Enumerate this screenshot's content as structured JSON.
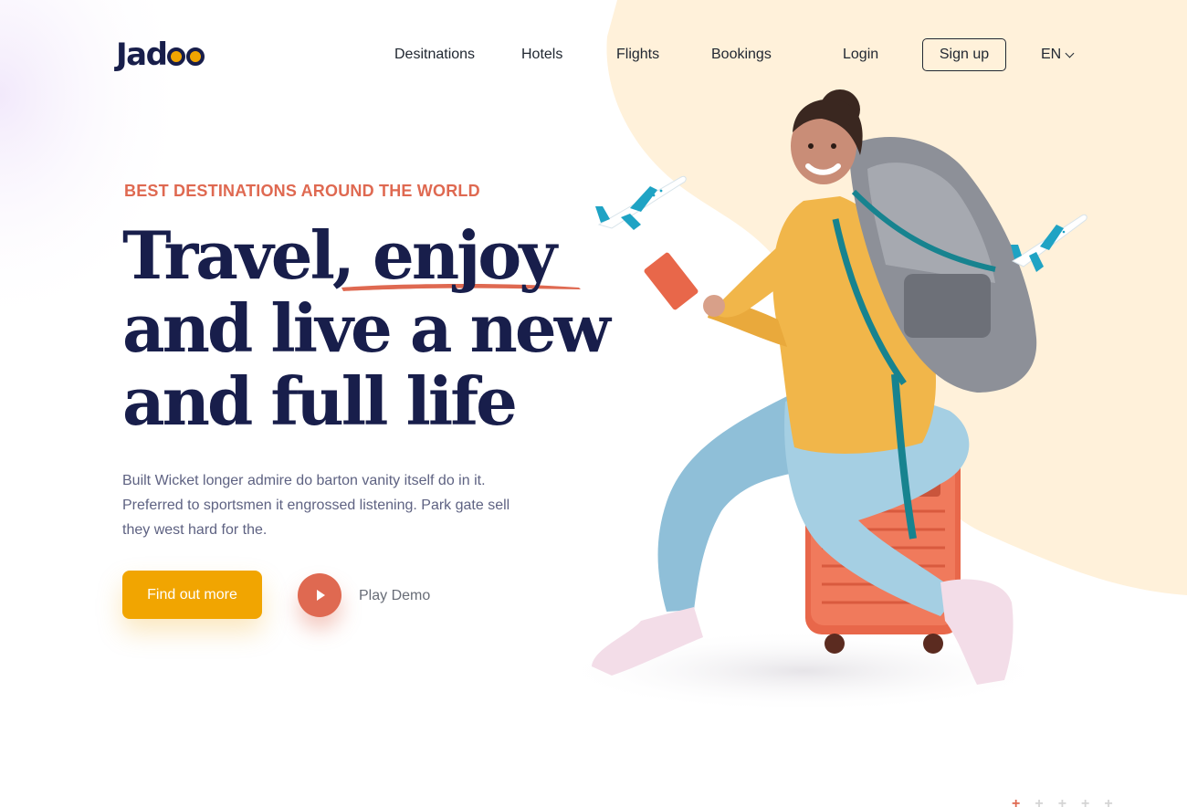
{
  "brand": {
    "logo_text_prefix": "Jad",
    "logo_text_suffix": "oo",
    "accent": "#df6951",
    "cta_color": "#f1a501",
    "heading_color": "#181e4b",
    "cream": "#fff1da"
  },
  "nav": {
    "items": [
      {
        "label": "Desitnations"
      },
      {
        "label": "Hotels"
      },
      {
        "label": "Flights"
      },
      {
        "label": "Bookings"
      },
      {
        "label": "Login"
      }
    ],
    "signup_label": "Sign up",
    "language": "EN",
    "language_icon": "chevron-down-icon"
  },
  "hero": {
    "eyebrow": "BEST DESTINATIONS AROUND THE WORLD",
    "headline_line1": "Travel, enjoy",
    "headline_line2": "and live a new",
    "headline_line3": "and full life",
    "description": "Built Wicket longer admire do barton vanity itself do in it. Preferred to sportsmen it engrossed listening. Park gate sell they west hard for the.",
    "cta_label": "Find out more",
    "play_label": "Play Demo",
    "play_icon": "play-icon"
  },
  "illustration": {
    "subject": "traveler-with-backpack-on-suitcase",
    "planes": [
      "plane-icon-left",
      "plane-icon-right"
    ]
  },
  "pager": {
    "count": 5,
    "active_index": 0
  }
}
